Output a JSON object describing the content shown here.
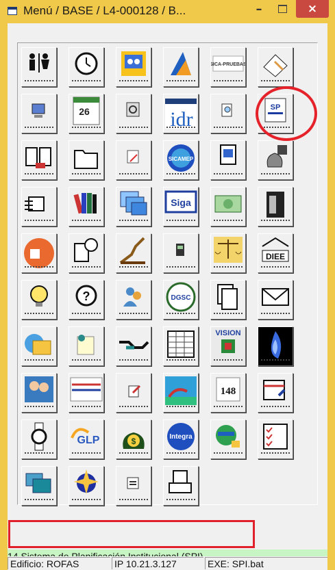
{
  "window": {
    "title": "Menú / BASE / L4-000128 / B...",
    "controls": {
      "minimize": "–",
      "close": "×"
    }
  },
  "apps": [
    {
      "icon": "restroom-icon"
    },
    {
      "icon": "clock-icon"
    },
    {
      "icon": "dgsp-icon"
    },
    {
      "icon": "blue-triangle-logo-icon"
    },
    {
      "icon": "sica-pruebas-icon",
      "label": "SICA-PRUEBAS"
    },
    {
      "icon": "paper-pencil-icon"
    },
    {
      "icon": "computer-user-icon"
    },
    {
      "icon": "calendar-icon",
      "label": "26"
    },
    {
      "icon": "magnifier-document-icon"
    },
    {
      "icon": "idr-logo-icon",
      "label": "idr"
    },
    {
      "icon": "search-document-icon"
    },
    {
      "icon": "spi-icon",
      "label": "SP"
    },
    {
      "icon": "open-book-icon"
    },
    {
      "icon": "folder-icon"
    },
    {
      "icon": "pencil-note-icon"
    },
    {
      "icon": "sicamep-globe-icon",
      "label": "SICAMEP"
    },
    {
      "icon": "document-sheet-icon"
    },
    {
      "icon": "money-bag-icon"
    },
    {
      "icon": "email-list-icon"
    },
    {
      "icon": "books-icon"
    },
    {
      "icon": "windows-stack-icon"
    },
    {
      "icon": "siga-icon",
      "label": "Siga"
    },
    {
      "icon": "money-bill-icon"
    },
    {
      "icon": "file-cabinet-icon"
    },
    {
      "icon": "orange-folder-icon"
    },
    {
      "icon": "book-clock-icon"
    },
    {
      "icon": "graph-growth-icon"
    },
    {
      "icon": "phone-icon"
    },
    {
      "icon": "scales-justice-icon"
    },
    {
      "icon": "diee-building-icon",
      "label": "DIEE"
    },
    {
      "icon": "lightbulb-icon"
    },
    {
      "icon": "help-question-icon",
      "label": "?"
    },
    {
      "icon": "users-icon"
    },
    {
      "icon": "dgsc-seal-icon",
      "label": "DGSC"
    },
    {
      "icon": "documents-icon"
    },
    {
      "icon": "envelope-icon"
    },
    {
      "icon": "globe-folder-icon"
    },
    {
      "icon": "pushpin-note-icon"
    },
    {
      "icon": "handshake-icon"
    },
    {
      "icon": "spreadsheet-icon"
    },
    {
      "icon": "vision-cube-icon",
      "label": "VISION"
    },
    {
      "icon": "blue-flame-icon"
    },
    {
      "icon": "people-icon"
    },
    {
      "icon": "banner-screen-icon"
    },
    {
      "icon": "edit-note-icon"
    },
    {
      "icon": "beach-island-icon"
    },
    {
      "icon": "numbers-148-icon",
      "label": "148"
    },
    {
      "icon": "calendar-edit-icon"
    },
    {
      "icon": "wristwatch-icon"
    },
    {
      "icon": "glp-logo-icon",
      "label": "GLP"
    },
    {
      "icon": "money-sack-icon",
      "label": "$"
    },
    {
      "icon": "integra-logo-icon",
      "label": "Integra"
    },
    {
      "icon": "globe-key-icon"
    },
    {
      "icon": "checklist-icon"
    },
    {
      "icon": "monitors-icon"
    },
    {
      "icon": "star-burst-icon"
    },
    {
      "icon": "window-form-icon"
    },
    {
      "icon": "printer-document-icon"
    }
  ],
  "description_bar": "14 Sistema de Planificación Institucional (SPI)",
  "status": {
    "edificio": "Edificio: ROFAS",
    "ip": "IP 10.21.3.127",
    "exe": "EXE: SPI.bat"
  },
  "colors": {
    "title_bar": "#f0c84a",
    "close_button": "#c9483f",
    "highlight": "#e5222a",
    "description_bar": "#c8f5c4",
    "window_bg": "#f0f0f0"
  }
}
